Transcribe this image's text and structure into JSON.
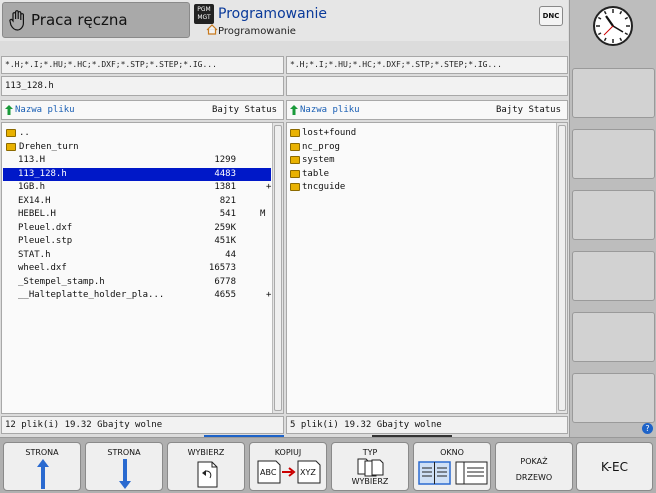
{
  "header": {
    "mode_left": "Praca ręczna",
    "mode_right": "Programowanie",
    "mode_right_sub": "Programowanie",
    "pgm_icon": "PGM MGT",
    "dnc": "DNC"
  },
  "left_panel": {
    "filter": "*.H;*.I;*.HU;*.HC;*.DXF;*.STP;*.STEP;*.IG...",
    "path": "113_128.h",
    "col_name": "Nazwa pliku",
    "col_size_status": "Bajty Status",
    "files": [
      {
        "name": "..",
        "size": "",
        "status": "",
        "folder": true
      },
      {
        "name": "Drehen_turn",
        "size": "",
        "status": "",
        "folder": true
      },
      {
        "name": "113.H",
        "size": "1299",
        "status": ""
      },
      {
        "name": "113_128.h",
        "size": "4483",
        "status": "",
        "selected": true
      },
      {
        "name": "1GB.h",
        "size": "1381",
        "status": "+"
      },
      {
        "name": "EX14.H",
        "size": "821",
        "status": ""
      },
      {
        "name": "HEBEL.H",
        "size": "541",
        "status": "M"
      },
      {
        "name": "Pleuel.dxf",
        "size": "259K",
        "status": ""
      },
      {
        "name": "Pleuel.stp",
        "size": "451K",
        "status": ""
      },
      {
        "name": "STAT.h",
        "size": "44",
        "status": ""
      },
      {
        "name": "wheel.dxf",
        "size": "16573",
        "status": ""
      },
      {
        "name": "_Stempel_stamp.h",
        "size": "6778",
        "status": ""
      },
      {
        "name": "__Halteplatte_holder_pla...",
        "size": "4655",
        "status": "+"
      }
    ],
    "status": "12  plik(i)  19.32 Gbajty wolne"
  },
  "right_panel": {
    "filter": "*.H;*.I;*.HU;*.HC;*.DXF;*.STP;*.STEP;*.IG...",
    "col_name": "Nazwa pliku",
    "col_size_status": "Bajty Status",
    "folders": [
      "lost+found",
      "nc_prog",
      "system",
      "table",
      "tncguide"
    ],
    "status": "5  plik(i)  19.32 Gbajty wolne"
  },
  "softkeys": {
    "strona_up": "STRONA",
    "strona_down": "STRONA",
    "wybierz": "WYBIERZ",
    "kopiuj": "KOPIUJ",
    "kopiuj_from": "ABC",
    "kopiuj_to": "XYZ",
    "typ": "TYP",
    "typ_sub": "WYBIERZ",
    "okno": "OKNO",
    "pokaz": "POKAŻ",
    "drzewo": "DRZEWO",
    "kec": "K-EC"
  },
  "help": "?",
  "icons": [
    "hand-icon",
    "pgm-mgt-icon",
    "home-icon",
    "clock-icon",
    "arrow-up-icon",
    "arrow-down-icon",
    "folder-icon",
    "copy-icon",
    "window-layout-icon",
    "help-icon"
  ],
  "colors": {
    "selection": "#0018c8",
    "accent": "#1e63c8",
    "folder": "#e8b100"
  }
}
